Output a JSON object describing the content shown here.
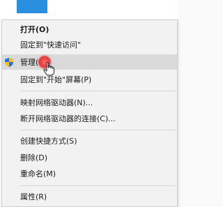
{
  "menu": {
    "items": [
      {
        "label": "打开(O)"
      },
      {
        "label": "固定到\"快速访问\""
      },
      {
        "label": "管理(G)"
      },
      {
        "label": "固定到\"开始\"屏幕(P)"
      },
      {
        "label": "映射网络驱动器(N)..."
      },
      {
        "label": "断开网络驱动器的连接(C)..."
      },
      {
        "label": "创建快捷方式(S)"
      },
      {
        "label": "删除(D)"
      },
      {
        "label": "重命名(M)"
      },
      {
        "label": "属性(R)"
      }
    ],
    "hovered_item": "管理(G)",
    "icons": {
      "manage": "uac-shield-icon"
    },
    "colors": {
      "hover_background": "#dadada",
      "click_marker": "#e23b3b",
      "menu_background": "#f2f2f2"
    }
  }
}
